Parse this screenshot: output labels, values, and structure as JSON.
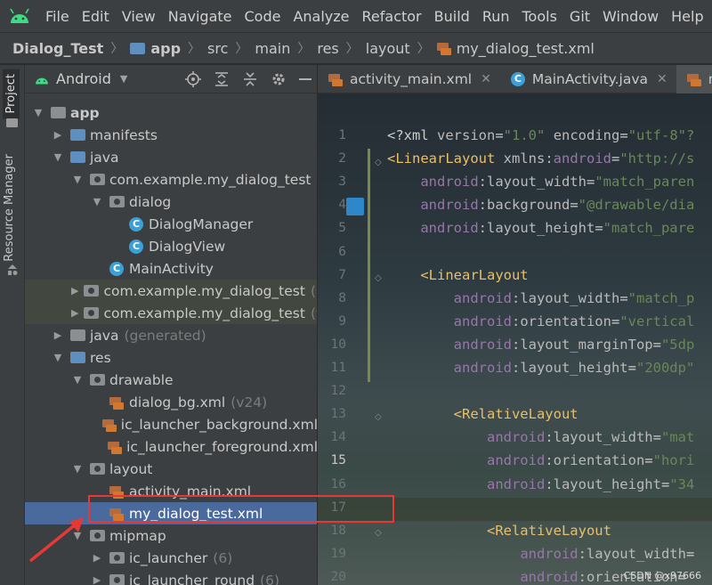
{
  "menu": {
    "items": [
      "File",
      "Edit",
      "View",
      "Navigate",
      "Code",
      "Analyze",
      "Refactor",
      "Build",
      "Run",
      "Tools",
      "Git",
      "Window",
      "Help"
    ]
  },
  "breadcrumb": {
    "items": [
      "Dialog_Test",
      "app",
      "src",
      "main",
      "res",
      "layout",
      "my_dialog_test.xml"
    ]
  },
  "left_strip": {
    "project_label": "Project",
    "resource_label": "Resource Manager"
  },
  "panel": {
    "title": "Android"
  },
  "tree": {
    "rows": [
      {
        "label": "app",
        "suffix": "",
        "icon": "module-folder-icon"
      },
      {
        "label": "manifests",
        "suffix": "",
        "icon": "folder-icon"
      },
      {
        "label": "java",
        "suffix": "",
        "icon": "folder-icon"
      },
      {
        "label": "com.example.my_dialog_test",
        "suffix": "",
        "icon": "package-icon"
      },
      {
        "label": "dialog",
        "suffix": "",
        "icon": "package-icon"
      },
      {
        "label": "DialogManager",
        "suffix": "",
        "icon": "class-icon"
      },
      {
        "label": "DialogView",
        "suffix": "",
        "icon": "class-icon"
      },
      {
        "label": "MainActivity",
        "suffix": "",
        "icon": "class-icon"
      },
      {
        "label": "com.example.my_dialog_test",
        "suffix": "(a",
        "icon": "package-icon"
      },
      {
        "label": "com.example.my_dialog_test",
        "suffix": "(t",
        "icon": "package-icon"
      },
      {
        "label": "java",
        "suffix": "(generated)",
        "icon": "generated-folder-icon"
      },
      {
        "label": "res",
        "suffix": "",
        "icon": "folder-icon"
      },
      {
        "label": "drawable",
        "suffix": "",
        "icon": "package-icon"
      },
      {
        "label": "dialog_bg.xml",
        "suffix": "(v24)",
        "icon": "xml-file-icon"
      },
      {
        "label": "ic_launcher_background.xml",
        "suffix": "",
        "icon": "xml-file-icon"
      },
      {
        "label": "ic_launcher_foreground.xml",
        "suffix": "",
        "icon": "xml-file-icon"
      },
      {
        "label": "layout",
        "suffix": "",
        "icon": "package-icon"
      },
      {
        "label": "activity_main.xml",
        "suffix": "",
        "icon": "xml-file-icon"
      },
      {
        "label": "my_dialog_test.xml",
        "suffix": "",
        "icon": "xml-file-icon"
      },
      {
        "label": "mipmap",
        "suffix": "",
        "icon": "package-icon"
      },
      {
        "label": "ic_launcher",
        "suffix": "(6)",
        "icon": "package-icon"
      },
      {
        "label": "ic_launcher_round",
        "suffix": "(6)",
        "icon": "package-icon"
      }
    ]
  },
  "tabs": [
    {
      "label": "activity_main.xml"
    },
    {
      "label": "MainActivity.java"
    },
    {
      "label": "my_d"
    }
  ],
  "editor": {
    "line_numbers": [
      "1",
      "2",
      "3",
      "4",
      "5",
      "6",
      "7",
      "8",
      "9",
      "10",
      "11",
      "12",
      "13",
      "14",
      "15",
      "16",
      "17",
      "18",
      "19",
      "20"
    ],
    "lines": [
      [
        {
          "t": "pun",
          "v": "<?xml "
        },
        {
          "t": "at",
          "v": "version"
        },
        {
          "t": "pun",
          "v": "="
        },
        {
          "t": "val",
          "v": "\"1.0\""
        },
        {
          "t": "pun",
          "v": " "
        },
        {
          "t": "at",
          "v": "encoding"
        },
        {
          "t": "pun",
          "v": "="
        },
        {
          "t": "val",
          "v": "\"utf-8\"?"
        }
      ],
      [
        {
          "t": "tag",
          "v": "<LinearLayout "
        },
        {
          "t": "at",
          "v": "xmlns:"
        },
        {
          "t": "ns",
          "v": "android"
        },
        {
          "t": "pun",
          "v": "="
        },
        {
          "t": "val",
          "v": "\"http://s"
        }
      ],
      [
        {
          "t": "pun",
          "v": "    "
        },
        {
          "t": "ns",
          "v": "android"
        },
        {
          "t": "at",
          "v": ":layout_width"
        },
        {
          "t": "pun",
          "v": "="
        },
        {
          "t": "val",
          "v": "\"match_paren"
        }
      ],
      [
        {
          "t": "pun",
          "v": "    "
        },
        {
          "t": "ns",
          "v": "android"
        },
        {
          "t": "at",
          "v": ":background"
        },
        {
          "t": "pun",
          "v": "="
        },
        {
          "t": "val",
          "v": "\"@drawable/dia"
        }
      ],
      [
        {
          "t": "pun",
          "v": "    "
        },
        {
          "t": "ns",
          "v": "android"
        },
        {
          "t": "at",
          "v": ":layout_height"
        },
        {
          "t": "pun",
          "v": "="
        },
        {
          "t": "val",
          "v": "\"match_pare"
        }
      ],
      [],
      [
        {
          "t": "pun",
          "v": "    "
        },
        {
          "t": "tag",
          "v": "<LinearLayout"
        }
      ],
      [
        {
          "t": "pun",
          "v": "        "
        },
        {
          "t": "ns",
          "v": "android"
        },
        {
          "t": "at",
          "v": ":layout_width"
        },
        {
          "t": "pun",
          "v": "="
        },
        {
          "t": "val",
          "v": "\"match_p"
        }
      ],
      [
        {
          "t": "pun",
          "v": "        "
        },
        {
          "t": "ns",
          "v": "android"
        },
        {
          "t": "at",
          "v": ":orientation"
        },
        {
          "t": "pun",
          "v": "="
        },
        {
          "t": "val",
          "v": "\"vertical"
        }
      ],
      [
        {
          "t": "pun",
          "v": "        "
        },
        {
          "t": "ns",
          "v": "android"
        },
        {
          "t": "at",
          "v": ":layout_marginTop"
        },
        {
          "t": "pun",
          "v": "="
        },
        {
          "t": "val",
          "v": "\"5dp"
        }
      ],
      [
        {
          "t": "pun",
          "v": "        "
        },
        {
          "t": "ns",
          "v": "android"
        },
        {
          "t": "at",
          "v": ":layout_height"
        },
        {
          "t": "pun",
          "v": "="
        },
        {
          "t": "val",
          "v": "\"200dp\""
        }
      ],
      [],
      [
        {
          "t": "pun",
          "v": "        "
        },
        {
          "t": "tag",
          "v": "<RelativeLayout"
        }
      ],
      [
        {
          "t": "pun",
          "v": "            "
        },
        {
          "t": "ns",
          "v": "android"
        },
        {
          "t": "at",
          "v": ":layout_width"
        },
        {
          "t": "pun",
          "v": "="
        },
        {
          "t": "val",
          "v": "\"mat"
        }
      ],
      [
        {
          "t": "pun",
          "v": "            "
        },
        {
          "t": "ns",
          "v": "android"
        },
        {
          "t": "at",
          "v": ":orientation"
        },
        {
          "t": "pun",
          "v": "="
        },
        {
          "t": "val",
          "v": "\"hori"
        }
      ],
      [
        {
          "t": "pun",
          "v": "            "
        },
        {
          "t": "ns",
          "v": "android"
        },
        {
          "t": "at",
          "v": ":layout_height"
        },
        {
          "t": "pun",
          "v": "="
        },
        {
          "t": "val",
          "v": "\"34"
        }
      ],
      [],
      [
        {
          "t": "pun",
          "v": "            "
        },
        {
          "t": "tag",
          "v": "<RelativeLayout"
        }
      ],
      [
        {
          "t": "pun",
          "v": "                "
        },
        {
          "t": "ns",
          "v": "android"
        },
        {
          "t": "at",
          "v": ":layout_width"
        },
        {
          "t": "pun",
          "v": "="
        }
      ],
      [
        {
          "t": "pun",
          "v": "                "
        },
        {
          "t": "ns",
          "v": "android"
        },
        {
          "t": "at",
          "v": ":orientation"
        },
        {
          "t": "pun",
          "v": "="
        }
      ]
    ]
  },
  "watermark": "CSDN @x97666",
  "colors": {
    "accent": "#4a6a9e",
    "annotation": "#e53935"
  }
}
